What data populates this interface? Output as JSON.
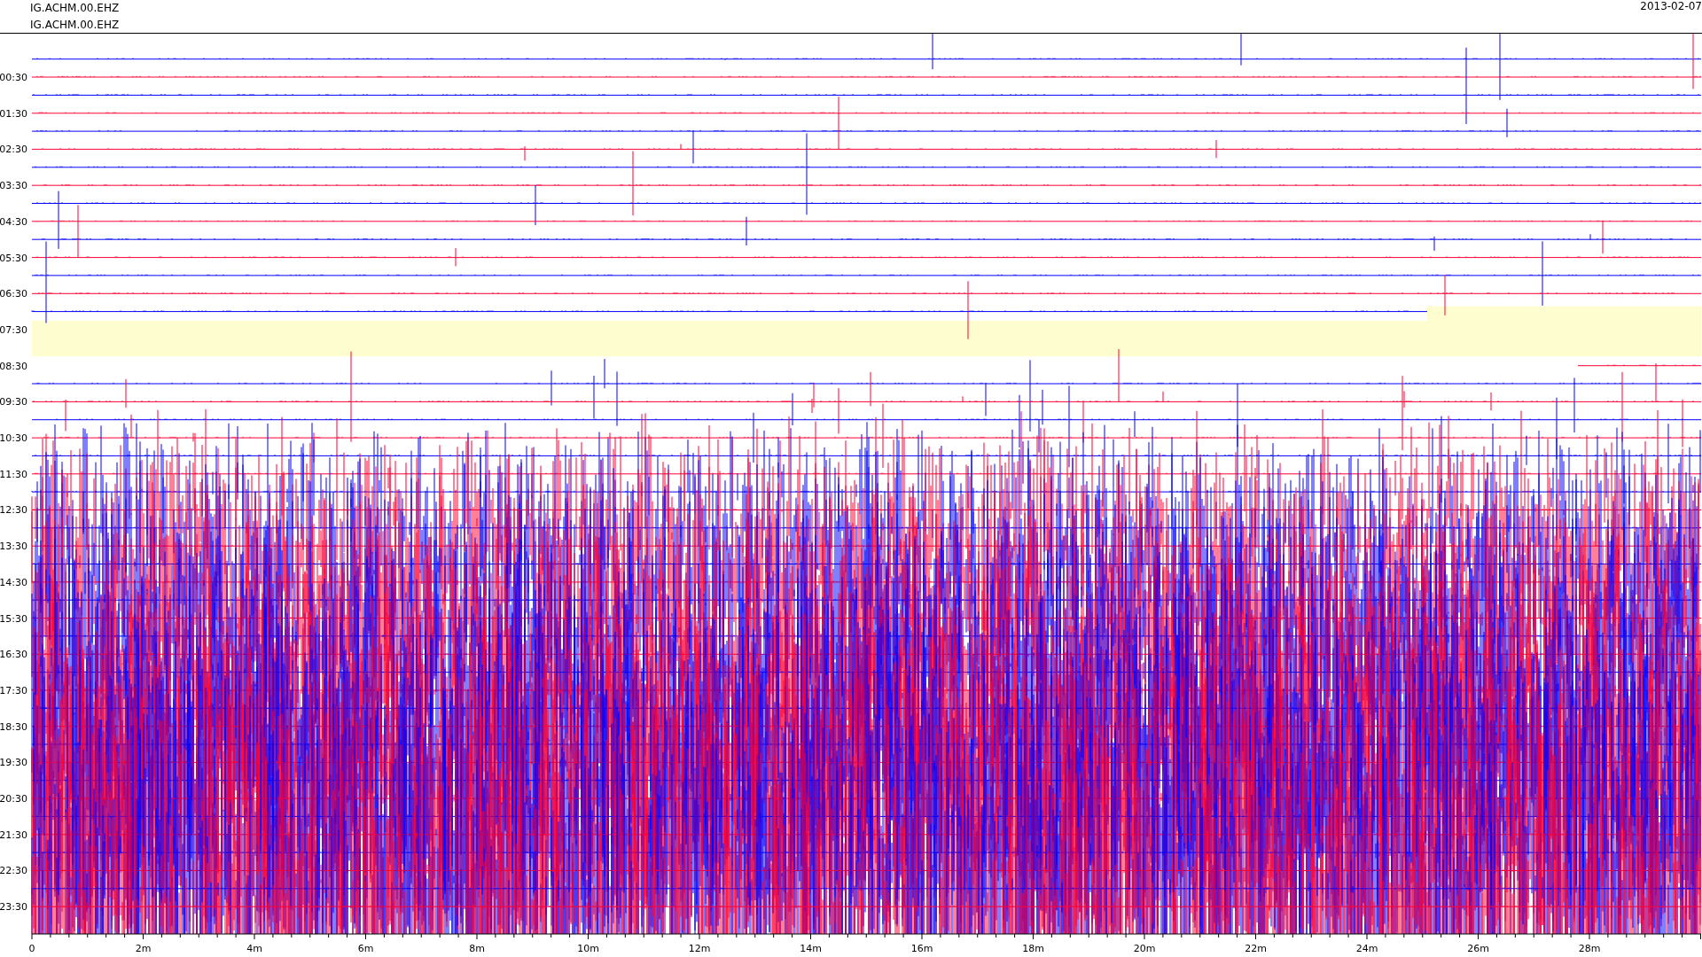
{
  "header": {
    "channel_lines": [
      "IG.ACHM.00.EHZ",
      "IG.ACHM.00.EHZ"
    ],
    "date": "2013-02-07"
  },
  "plot": {
    "hour_labels": [
      "00:30",
      "01:30",
      "02:30",
      "03:30",
      "04:30",
      "05:30",
      "06:30",
      "07:30",
      "08:30",
      "09:30",
      "10:30",
      "11:30",
      "12:30",
      "13:30",
      "14:30",
      "15:30",
      "16:30",
      "17:30",
      "18:30",
      "19:30",
      "20:30",
      "21:30",
      "22:30",
      "23:30"
    ],
    "minute_labels": [
      "0",
      "2m",
      "4m",
      "6m",
      "8m",
      "10m",
      "12m",
      "14m",
      "16m",
      "18m",
      "20m",
      "22m",
      "24m",
      "26m",
      "28m"
    ]
  }
}
